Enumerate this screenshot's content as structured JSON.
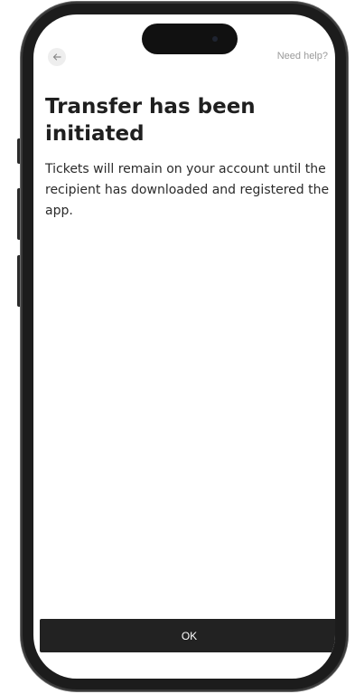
{
  "header": {
    "back_icon": "arrow-left-icon",
    "help_label": "Need help?"
  },
  "content": {
    "title": "Transfer has been initiated",
    "body": "Tickets will remain on your account until the recipient has downloaded and registered the app."
  },
  "footer": {
    "ok_label": "OK"
  },
  "colors": {
    "button_background": "#222222",
    "button_text": "#ffffff",
    "title_text": "#1f1f1f",
    "help_text": "#9a9a9a"
  }
}
